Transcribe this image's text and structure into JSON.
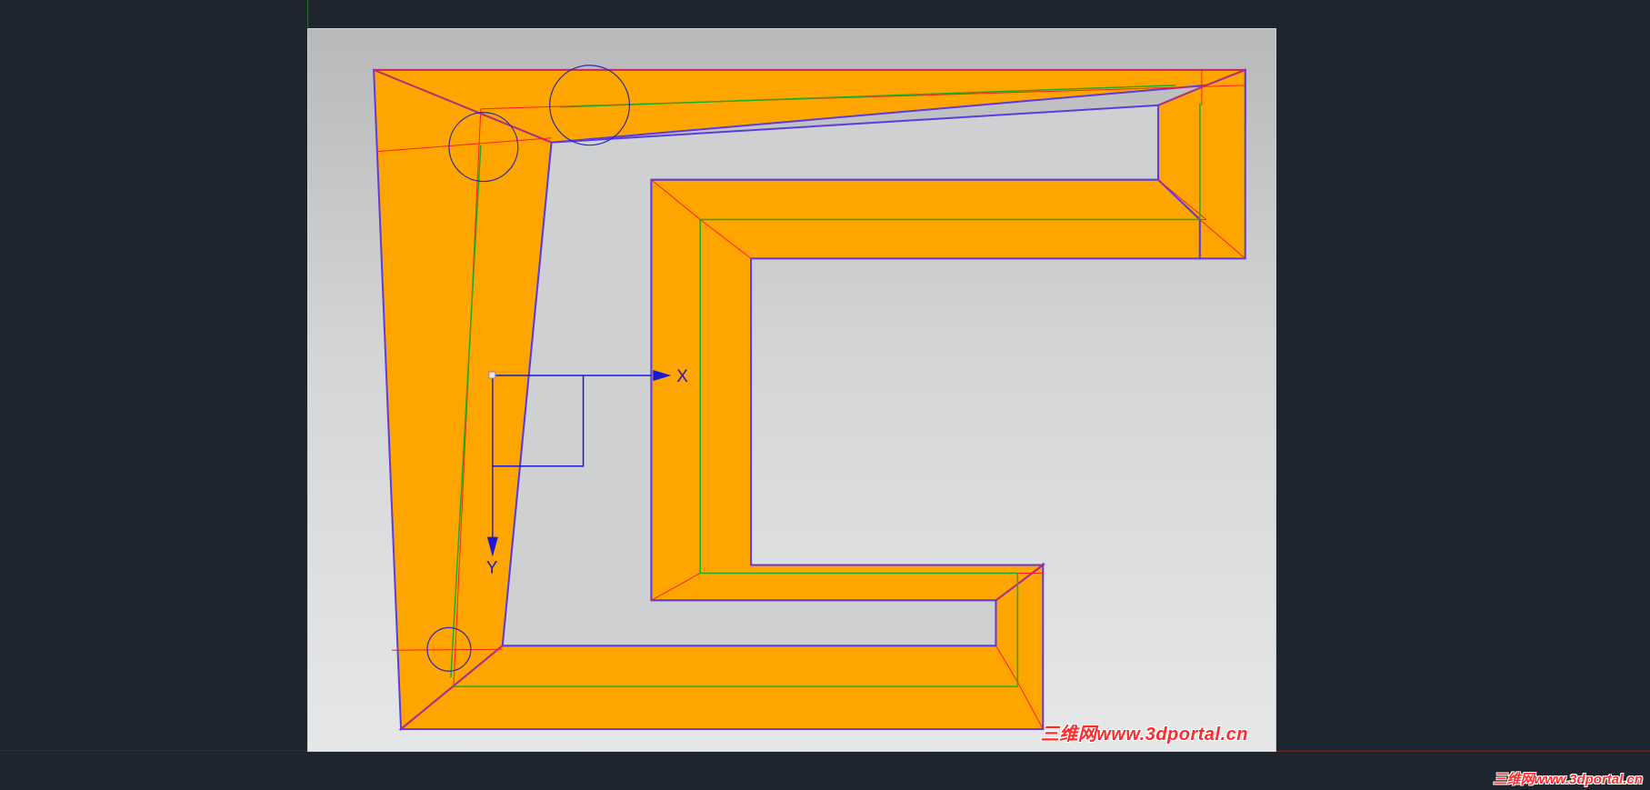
{
  "viewport": {
    "axes": {
      "x_label": "X",
      "y_label": "Y"
    },
    "colors": {
      "fill": "#ffa500",
      "outline": "#5a3ce0",
      "red_lines": "#ff2020",
      "green_lines": "#18b020",
      "axis": "#1a1ad6"
    },
    "watermark": "三维网www.3dportal.cn"
  },
  "corner_watermark": "三维网www.3dportal.cn"
}
